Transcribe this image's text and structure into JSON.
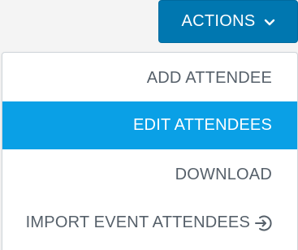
{
  "actions_button": {
    "label": "ACTIONS",
    "icon": "chevron-down-icon",
    "background": "#0077b0",
    "text_color": "#ffffff"
  },
  "menu": {
    "items": [
      {
        "label": "ADD ATTENDEE",
        "selected": false
      },
      {
        "label": "EDIT ATTENDEES",
        "selected": true
      },
      {
        "label": "DOWNLOAD",
        "selected": false
      },
      {
        "label": "IMPORT EVENT ATTENDEES",
        "selected": false,
        "icon": "import-arrow-circle-icon"
      }
    ],
    "highlight_color": "#0aa0e6",
    "text_color": "#56606a"
  }
}
